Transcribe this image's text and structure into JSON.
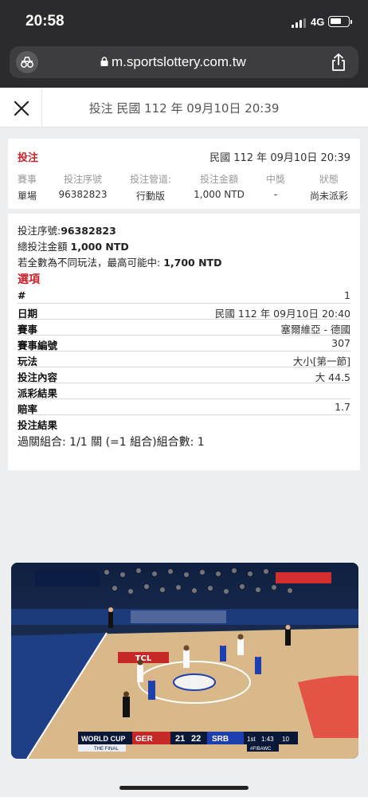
{
  "status_bar": {
    "time": "20:58",
    "network": "4G"
  },
  "browser": {
    "url": "m.sportslottery.com.tw"
  },
  "header": {
    "title": "投注 民國 112 年 09月10日 20:39"
  },
  "summary": {
    "label": "投注",
    "date": "民國 112 年 09月10日 20:39",
    "columns": [
      {
        "header": "賽事",
        "value": "單場"
      },
      {
        "header": "投注序號",
        "value": "96382823"
      },
      {
        "header": "投注管道:",
        "value": "行動版"
      },
      {
        "header": "投注金額",
        "value": "1,000 NTD"
      },
      {
        "header": "中獎",
        "value": "-"
      },
      {
        "header": "狀態",
        "value": "尚未派彩"
      }
    ]
  },
  "detail": {
    "serial_label": "投注序號:",
    "serial_value": "96382823",
    "total_label": "總投注金額",
    "total_value": "1,000 NTD",
    "max_label": "若全數為不同玩法，最高可能中:",
    "max_value": "1,700 NTD",
    "options_title": "選項",
    "rows": [
      {
        "key": "#",
        "value": "1"
      },
      {
        "key": "日期",
        "value": "民國 112 年 09月10日 20:40"
      },
      {
        "key": "賽事",
        "value": "塞爾維亞 - 德國"
      },
      {
        "key": "賽事編號",
        "value": "307"
      },
      {
        "key": "玩法",
        "value": "大小[第一節]"
      },
      {
        "key": "投注內容",
        "value": "大 44.5"
      },
      {
        "key": "派彩結果",
        "value": ""
      },
      {
        "key": "賠率",
        "value": "1.7"
      },
      {
        "key": "投注結果",
        "value": ""
      }
    ],
    "parlay": "過關組合: 1/1 關 (=1 組合)組合數: 1"
  },
  "broadcast": {
    "team_home": "GER",
    "score_home": "21",
    "score_away": "22",
    "team_away": "SRB",
    "period": "1st",
    "clock": "1:43",
    "shot_clock": "10",
    "event": "WORLD CUP",
    "stage": "THE FINAL",
    "hashtag": "#FIBAWC",
    "court_ad": "TCL",
    "colors": {
      "home": "#c62828",
      "away": "#1e40af",
      "court": "#d9b98a"
    }
  }
}
